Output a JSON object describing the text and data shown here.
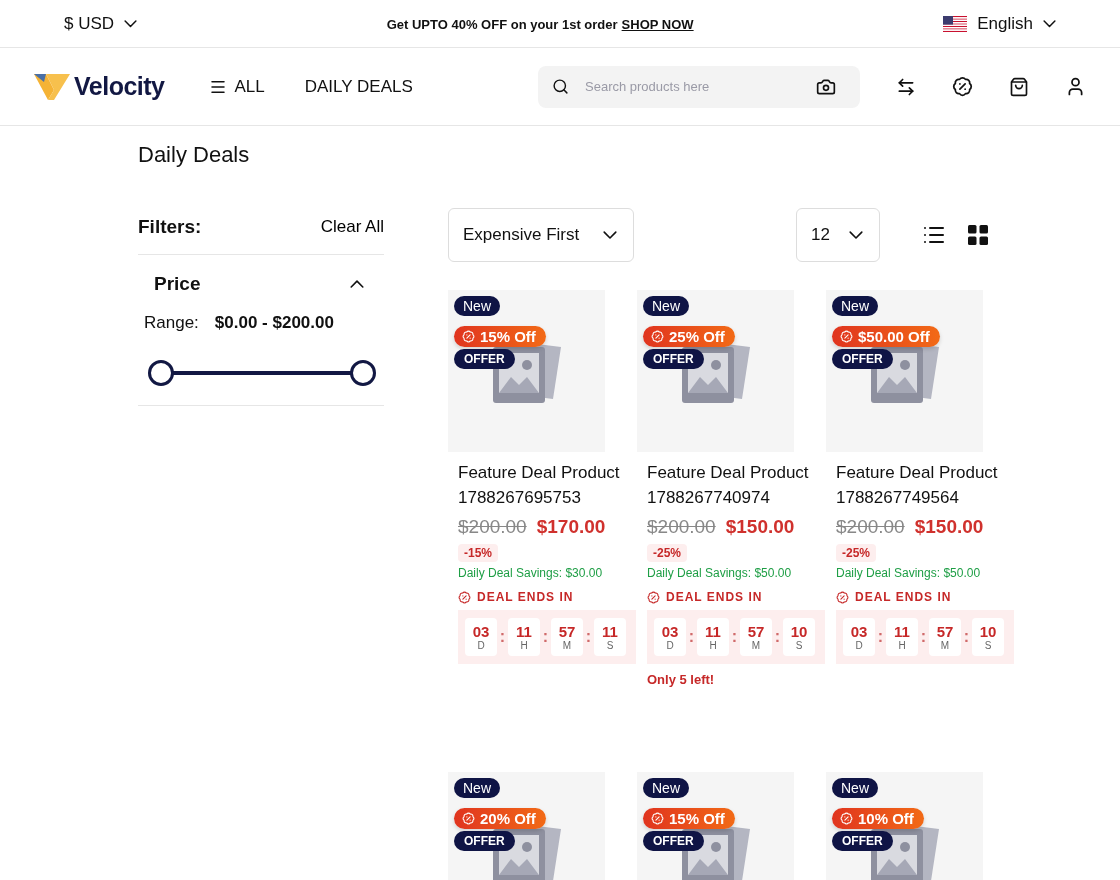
{
  "top_bar": {
    "currency": "$ USD",
    "promo": {
      "text": "Get UPTO 40% OFF on your 1st order",
      "link": "SHOP NOW"
    },
    "language": "English"
  },
  "nav": {
    "logo": "Velocity",
    "menu": [
      {
        "label": "ALL",
        "kind": "menu"
      },
      {
        "label": "DAILY DEALS",
        "kind": "link"
      }
    ],
    "search": {
      "placeholder": "Search products here"
    }
  },
  "page_title": "Daily Deals",
  "filters": {
    "title": "Filters:",
    "clear": "Clear All",
    "sections": [
      {
        "title": "Price",
        "expanded": true,
        "range_label": "Range:",
        "range_value": "$0.00 - $200.00",
        "thumbs": [
          {
            "level": 0
          },
          {
            "level": 1
          }
        ]
      }
    ]
  },
  "toolbar": {
    "sort": "Expensive First",
    "per_page": "12"
  },
  "products": [
    {
      "badge": "New",
      "discount": "15% Off",
      "offer": "OFFER",
      "title": "Feature Deal Product 1788267695753",
      "old_price": "$200.00",
      "price": "$170.00",
      "percent": "-15%",
      "savings": "Daily Deal Savings: $30.00",
      "deal_label": "DEAL ENDS IN",
      "separator": ":",
      "countdown": [
        {
          "value": "03",
          "unit": "D"
        },
        {
          "value": "11",
          "unit": "H"
        },
        {
          "value": "57",
          "unit": "M"
        },
        {
          "value": "11",
          "unit": "S"
        }
      ]
    },
    {
      "badge": "New",
      "discount": "25% Off",
      "offer": "OFFER",
      "title": "Feature Deal Product 1788267740974",
      "old_price": "$200.00",
      "price": "$150.00",
      "percent": "-25%",
      "savings": "Daily Deal Savings: $50.00",
      "deal_label": "DEAL ENDS IN",
      "separator": ":",
      "countdown": [
        {
          "value": "03",
          "unit": "D"
        },
        {
          "value": "11",
          "unit": "H"
        },
        {
          "value": "57",
          "unit": "M"
        },
        {
          "value": "10",
          "unit": "S"
        }
      ],
      "stock": "Only 5 left!"
    },
    {
      "badge": "New",
      "discount": "$50.00 Off",
      "offer": "OFFER",
      "title": "Feature Deal Product 1788267749564",
      "old_price": "$200.00",
      "price": "$150.00",
      "percent": "-25%",
      "savings": "Daily Deal Savings: $50.00",
      "deal_label": "DEAL ENDS IN",
      "separator": ":",
      "countdown": [
        {
          "value": "03",
          "unit": "D"
        },
        {
          "value": "11",
          "unit": "H"
        },
        {
          "value": "57",
          "unit": "M"
        },
        {
          "value": "10",
          "unit": "S"
        }
      ]
    },
    {
      "badge": "New",
      "discount": "20% Off",
      "offer": "OFFER"
    },
    {
      "badge": "New",
      "discount": "15% Off",
      "offer": "OFFER"
    },
    {
      "badge": "New",
      "discount": "10% Off",
      "offer": "OFFER"
    }
  ]
}
